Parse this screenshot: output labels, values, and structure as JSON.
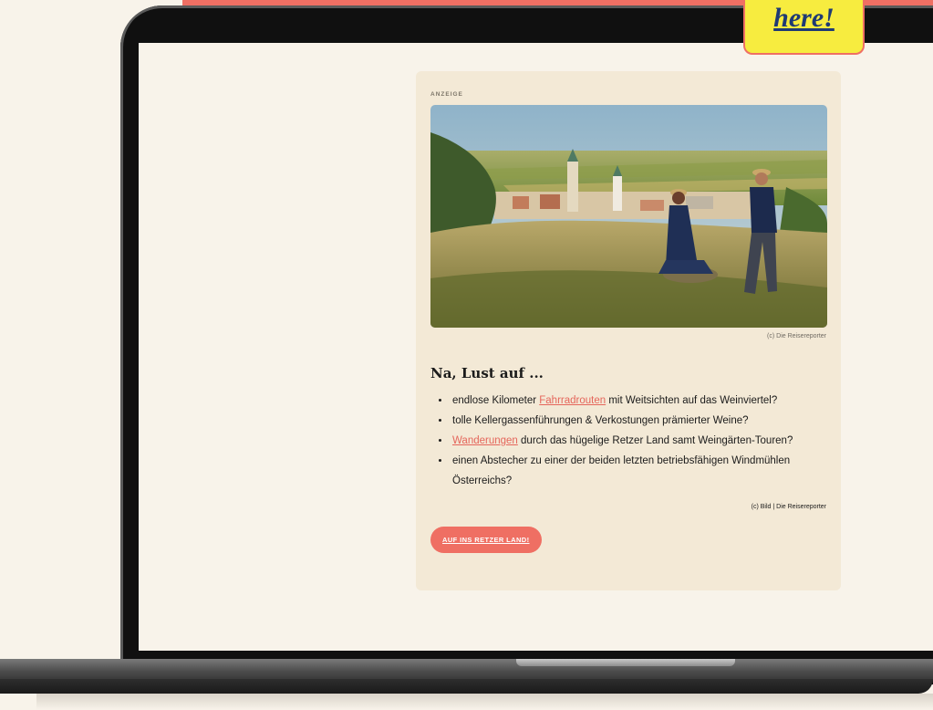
{
  "sticky_note": {
    "text": "here!"
  },
  "ad": {
    "label": "ANZEIGE",
    "image_credit": "(c) Die Reisereporter",
    "heading": "Na, Lust auf ...",
    "list": [
      {
        "before": "endlose Kilometer ",
        "link": "Fahrradrouten",
        "after": " mit Weitsichten auf das Weinviertel?"
      },
      {
        "before": "tolle Kellergassenführungen & Verkostungen prämierter Weine?",
        "link": "",
        "after": ""
      },
      {
        "before": "",
        "link": "Wanderungen",
        "after": " durch das hügelige Retzer Land samt Weingärten-Touren?"
      },
      {
        "before": "einen Abstecher zu einer der beiden letzten betriebsfähigen Windmühlen Österreichs?",
        "link": "",
        "after": ""
      }
    ],
    "bottom_credit": "(c) Bild | Die Reisereporter",
    "cta_label": "AUF INS RETZER LAND!"
  },
  "colors": {
    "accent": "#ef6f63",
    "card_bg": "#f3e9d6",
    "page_bg": "#f8f3ea",
    "sticky_bg": "#f7ec3f",
    "link": "#e5665b"
  }
}
